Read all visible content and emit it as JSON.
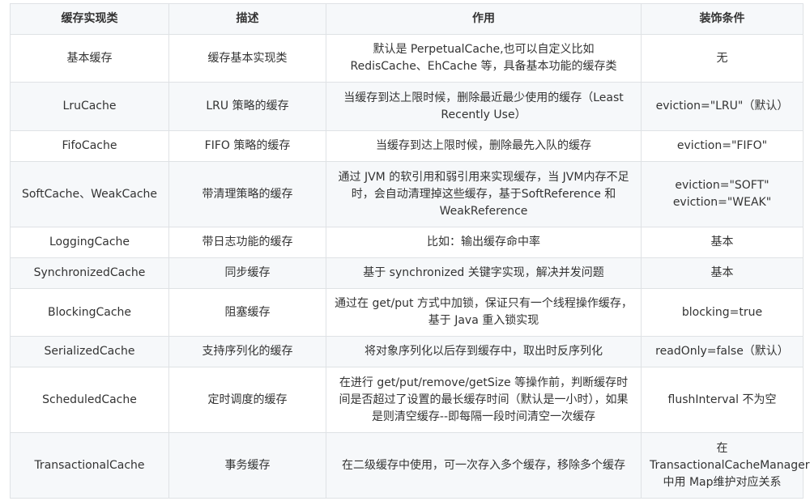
{
  "headers": [
    "缓存实现类",
    "描述",
    "作用",
    "装饰条件"
  ],
  "rows": [
    [
      "基本缓存",
      "缓存基本实现类",
      "默认是 PerpetualCache,也可以自定义比如RedisCache、EhCache 等，具备基本功能的缓存类",
      "无"
    ],
    [
      "LruCache",
      "LRU 策略的缓存",
      "当缓存到达上限时候，删除最近最少使用的缓存（Least Recently Use）",
      "eviction=\"LRU\"（默认）"
    ],
    [
      "FifoCache",
      "FIFO 策略的缓存",
      "当缓存到达上限时候，删除最先入队的缓存",
      "eviction=\"FIFO\""
    ],
    [
      "SoftCache、WeakCache",
      "带清理策略的缓存",
      "通过 JVM 的软引用和弱引用来实现缓存，当 JVM内存不足时，会自动清理掉这些缓存，基于SoftReference 和 WeakReference",
      "eviction=\"SOFT\" eviction=\"WEAK\""
    ],
    [
      "LoggingCache",
      "带日志功能的缓存",
      "比如：输出缓存命中率",
      "基本"
    ],
    [
      "SynchronizedCache",
      "同步缓存",
      "基于 synchronized 关键字实现，解决并发问题",
      "基本"
    ],
    [
      "BlockingCache",
      "阻塞缓存",
      "通过在 get/put 方式中加锁，保证只有一个线程操作缓存，基于 Java 重入锁实现",
      "blocking=true"
    ],
    [
      "SerializedCache",
      "支持序列化的缓存",
      "将对象序列化以后存到缓存中，取出时反序列化",
      "readOnly=false（默认）"
    ],
    [
      "ScheduledCache",
      "定时调度的缓存",
      "在进行 get/put/remove/getSize 等操作前，判断缓存时间是否超过了设置的最长缓存时间（默认是一小时），如果是则清空缓存--即每隔一段时间清空一次缓存",
      "flushInterval 不为空"
    ],
    [
      "TransactionalCache",
      "事务缓存",
      "在二级缓存中使用，可一次存入多个缓存，移除多个缓存",
      "在 TransactionalCacheManager 中用 Map维护对应关系"
    ]
  ]
}
